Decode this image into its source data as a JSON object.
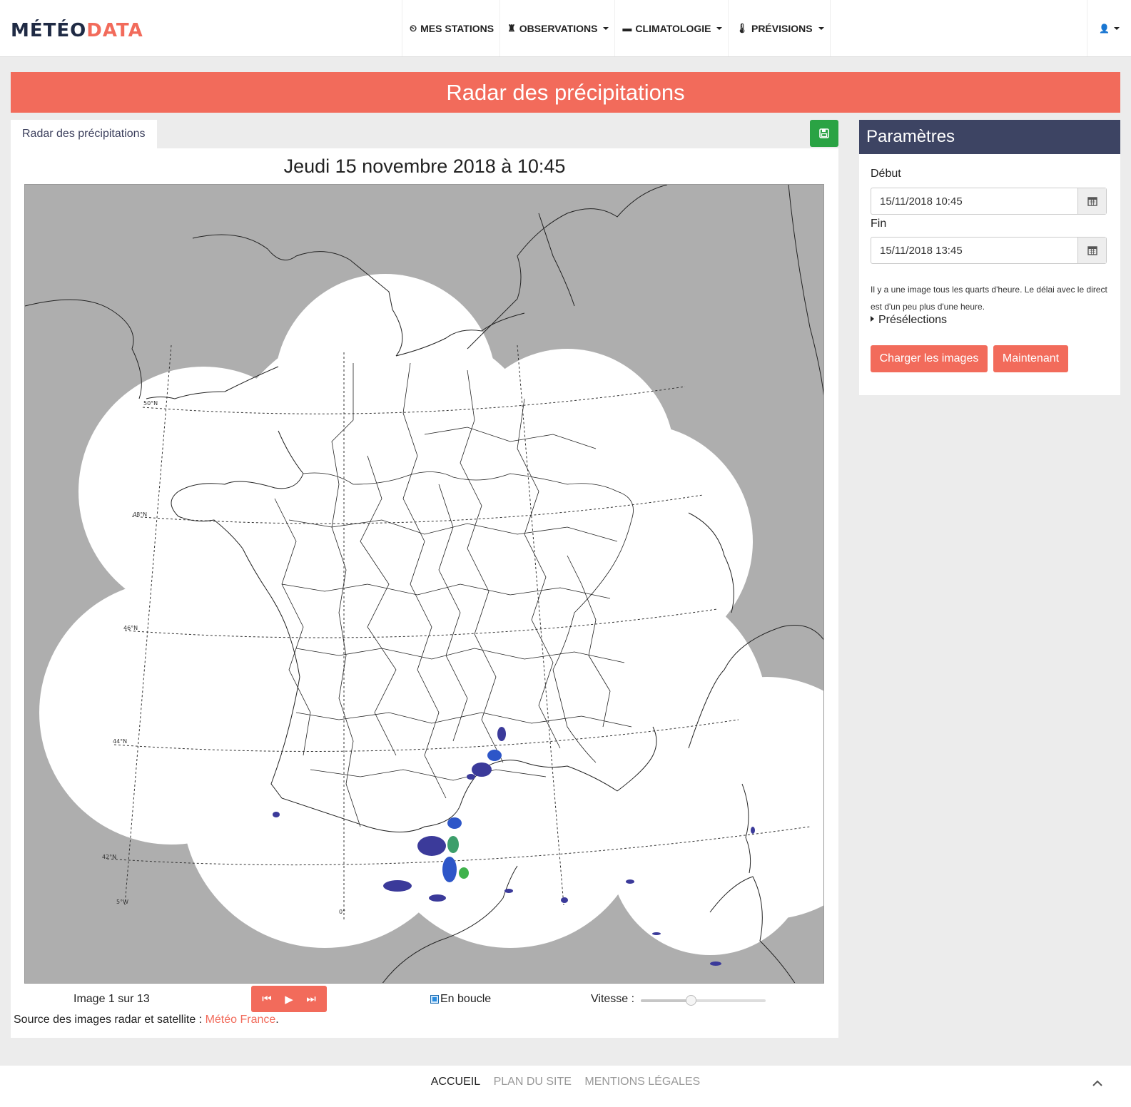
{
  "brand": {
    "part1": "MÉTÉO",
    "part2": "DATA"
  },
  "nav": {
    "items": [
      {
        "icon": "⏲",
        "label": "MES STATIONS",
        "dropdown": false
      },
      {
        "icon": "♜",
        "label": "OBSERVATIONS",
        "dropdown": true
      },
      {
        "icon": "▬",
        "label": "CLIMATOLOGIE",
        "dropdown": true
      },
      {
        "icon": "🌡",
        "label": "PRÉVISIONS",
        "dropdown": true
      }
    ],
    "user_icon": "👤"
  },
  "banner": {
    "title": "Radar des précipitations"
  },
  "tab": {
    "label": "Radar des précipitations"
  },
  "map": {
    "title": "Jeudi 15 novembre 2018 à 10:45",
    "lat_labels": [
      "50°N",
      "48°N",
      "46°N",
      "44°N",
      "42°N"
    ],
    "lon_labels": [
      "5°W",
      "0°"
    ]
  },
  "controls": {
    "image_counter": "Image 1 sur 13",
    "loop_label": "En boucle",
    "speed_label": "Vitesse :",
    "speed_value": 0.4
  },
  "source": {
    "prefix": "Source des images radar et satellite : ",
    "link": "Météo France",
    "suffix": "."
  },
  "params": {
    "title": "Paramètres",
    "start_label": "Début",
    "start_value": "15/11/2018 10:45",
    "end_label": "Fin",
    "end_value": "15/11/2018 13:45",
    "note": "Il y a une image tous les quarts d'heure. Le délai avec le direct est d'un peu plus d'une heure.",
    "presel": "Présélections",
    "load_button": "Charger les images",
    "now_button": "Maintenant"
  },
  "footer": {
    "links": [
      "ACCUEIL",
      "PLAN DU SITE",
      "MENTIONS LÉGALES"
    ],
    "active": "ACCUEIL"
  },
  "colors": {
    "accent": "#f26b5b",
    "header": "#3d4463",
    "success": "#2aa344"
  }
}
